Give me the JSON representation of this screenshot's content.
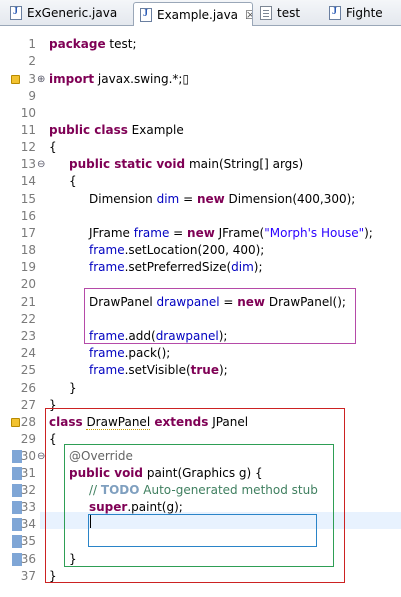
{
  "tabs": [
    {
      "label": "ExGeneric.java",
      "icon": "java-file-icon",
      "active": false
    },
    {
      "label": "Example.java",
      "icon": "java-file-icon",
      "active": true,
      "close": "☒"
    },
    {
      "label": "test",
      "icon": "text-file-icon",
      "active": false
    },
    {
      "label": "Fighte",
      "icon": "java-file-icon",
      "active": false
    }
  ],
  "editor": {
    "line_numbers": [
      "1",
      "2",
      "3",
      "9",
      "10",
      "11",
      "12",
      "13",
      "14",
      "15",
      "16",
      "17",
      "18",
      "19",
      "20",
      "21",
      "22",
      "23",
      "24",
      "25",
      "26",
      "27",
      "28",
      "29",
      "30",
      "31",
      "32",
      "33",
      "34",
      "35",
      "36",
      "37"
    ],
    "lines": {
      "l1": {
        "kw": "package",
        "rest": " test;"
      },
      "l3": {
        "kw": "import",
        "rest": " javax.swing.*;",
        "box": "▯"
      },
      "l11": {
        "kw": "public class",
        "rest": " Example"
      },
      "l12": {
        "text": "{"
      },
      "l13": {
        "kw": "public static void",
        "rest": " main(String[] args)"
      },
      "l14": {
        "text": "{"
      },
      "l15": {
        "a": "Dimension ",
        "var": "dim",
        "b": " = ",
        "kw": "new",
        "c": " Dimension(400,300);"
      },
      "l17": {
        "a": "JFrame ",
        "var": "frame",
        "b": " = ",
        "kw": "new",
        "c": " JFrame(",
        "str": "\"Morph's House\"",
        "d": ");"
      },
      "l18": {
        "var": "frame",
        "c": ".setLocation(200, 400);"
      },
      "l19": {
        "var": "frame",
        "c": ".setPreferredSize(",
        "var2": "dim",
        "d": ");"
      },
      "l21": {
        "a": "DrawPanel ",
        "var": "drawpanel",
        "b": " = ",
        "kw": "new",
        "c": " DrawPanel();"
      },
      "l23": {
        "var": "frame",
        "c": ".add(",
        "var2": "drawpanel",
        "d": ");"
      },
      "l24": {
        "var": "frame",
        "c": ".pack();"
      },
      "l25": {
        "var": "frame",
        "c": ".setVisible(",
        "kw": "true",
        "d": ");"
      },
      "l26": {
        "text": "}"
      },
      "l27": {
        "text": "}"
      },
      "l28": {
        "kw": "class",
        "a": " ",
        "warn": "DrawPanel",
        "kw2": " extends",
        "c": " JPanel"
      },
      "l29": {
        "text": "{"
      },
      "l30": {
        "ann": "@Override"
      },
      "l31": {
        "kw": "public void",
        "c": " paint(Graphics g) {"
      },
      "l32": {
        "cmt": "// ",
        "todo": "TODO",
        "cmt2": " Auto-generated method stub"
      },
      "l33": {
        "kw": "super",
        "c": ".paint(g);"
      },
      "l36": {
        "text": "}"
      },
      "l37": {
        "text": "}"
      }
    },
    "fold_markers": {
      "collapsed": "⊕",
      "expanded": "⊖"
    },
    "colors": {
      "keyword": "#7f0055",
      "field": "#0000c0",
      "string": "#2a00ff",
      "comment": "#3f7f5f",
      "todo": "#7f9fbf",
      "annotation": "#646464"
    }
  }
}
